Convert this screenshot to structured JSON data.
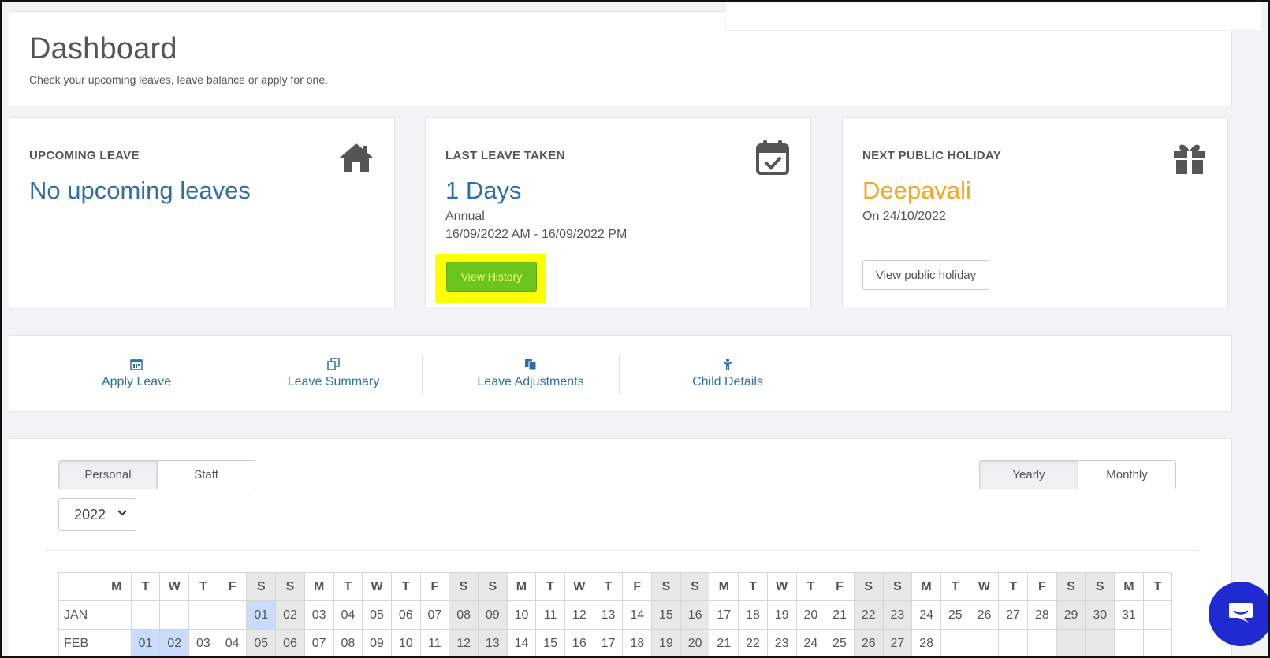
{
  "header": {
    "title": "Dashboard",
    "subtitle": "Check your upcoming leaves, leave balance or apply for one."
  },
  "cards": {
    "upcoming": {
      "label": "UPCOMING LEAVE",
      "value": "No upcoming leaves",
      "icon": "home-icon"
    },
    "last": {
      "label": "LAST LEAVE TAKEN",
      "value": "1 Days",
      "type": "Annual",
      "range": "16/09/2022 AM - 16/09/2022 PM",
      "button": "View History",
      "icon": "calendar-check-icon"
    },
    "holiday": {
      "label": "NEXT PUBLIC HOLIDAY",
      "value": "Deepavali",
      "date": "On 24/10/2022",
      "button": "View public holiday",
      "icon": "gift-icon"
    }
  },
  "nav": [
    {
      "label": "Apply Leave",
      "icon": "calendar-icon"
    },
    {
      "label": "Leave Summary",
      "icon": "documents-icon"
    },
    {
      "label": "Leave Adjustments",
      "icon": "file-copy-icon"
    },
    {
      "label": "Child Details",
      "icon": "child-icon"
    }
  ],
  "calendar": {
    "scope_tabs": [
      "Personal",
      "Staff"
    ],
    "scope_active": "Personal",
    "view_tabs": [
      "Yearly",
      "Monthly"
    ],
    "view_active": "Yearly",
    "year": "2022",
    "weekday_headers": [
      "M",
      "T",
      "W",
      "T",
      "F",
      "S",
      "S",
      "M",
      "T",
      "W",
      "T",
      "F",
      "S",
      "S",
      "M",
      "T",
      "W",
      "T",
      "F",
      "S",
      "S",
      "M",
      "T",
      "W",
      "T",
      "F",
      "S",
      "S",
      "M",
      "T",
      "W",
      "T",
      "F",
      "S",
      "S",
      "M",
      "T"
    ],
    "months": [
      {
        "name": "JAN",
        "offset": 5,
        "days": 31,
        "highlight": [
          1
        ]
      },
      {
        "name": "FEB",
        "offset": 1,
        "days": 28,
        "highlight": [
          1,
          2
        ]
      }
    ]
  },
  "colors": {
    "accent_blue": "#2f6fa8",
    "holiday_orange": "#f5a623",
    "history_button": "#6cc51d",
    "highlight_yellow": "#ffff00",
    "weekend_cell": "#e8e8e8",
    "holiday_cell": "#c9dcfb",
    "chat_button": "#1f2bd1"
  },
  "chat": {
    "icon": "chat-bubble-icon"
  }
}
